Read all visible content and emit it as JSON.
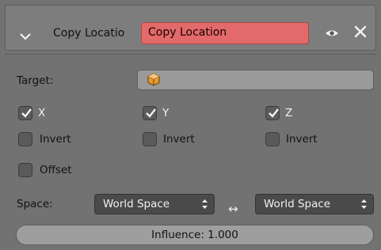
{
  "header": {
    "constraint_type_label": "Copy Locatio",
    "constraint_name": "Copy Location"
  },
  "target": {
    "label": "Target:",
    "value": ""
  },
  "axes": [
    {
      "label": "X",
      "checked": true
    },
    {
      "label": "Y",
      "checked": true
    },
    {
      "label": "Z",
      "checked": true
    }
  ],
  "invert": [
    {
      "label": "Invert",
      "checked": false
    },
    {
      "label": "Invert",
      "checked": false
    },
    {
      "label": "Invert",
      "checked": false
    }
  ],
  "offset": {
    "label": "Offset",
    "checked": false
  },
  "space": {
    "label": "Space:",
    "owner": "World Space",
    "target": "World Space"
  },
  "influence": {
    "label": "Influence: 1.000",
    "value": 1.0
  },
  "colors": {
    "panel": "#727272",
    "name_field_error": "#e36a6a",
    "checkbox": "#5a5a5a",
    "select": "#4a4a4a"
  },
  "icons": [
    "collapse-arrow-icon",
    "eye-icon",
    "close-icon",
    "object-cube-icon",
    "checkmark-icon",
    "up-down-arrows-icon",
    "swap-arrows-icon"
  ]
}
